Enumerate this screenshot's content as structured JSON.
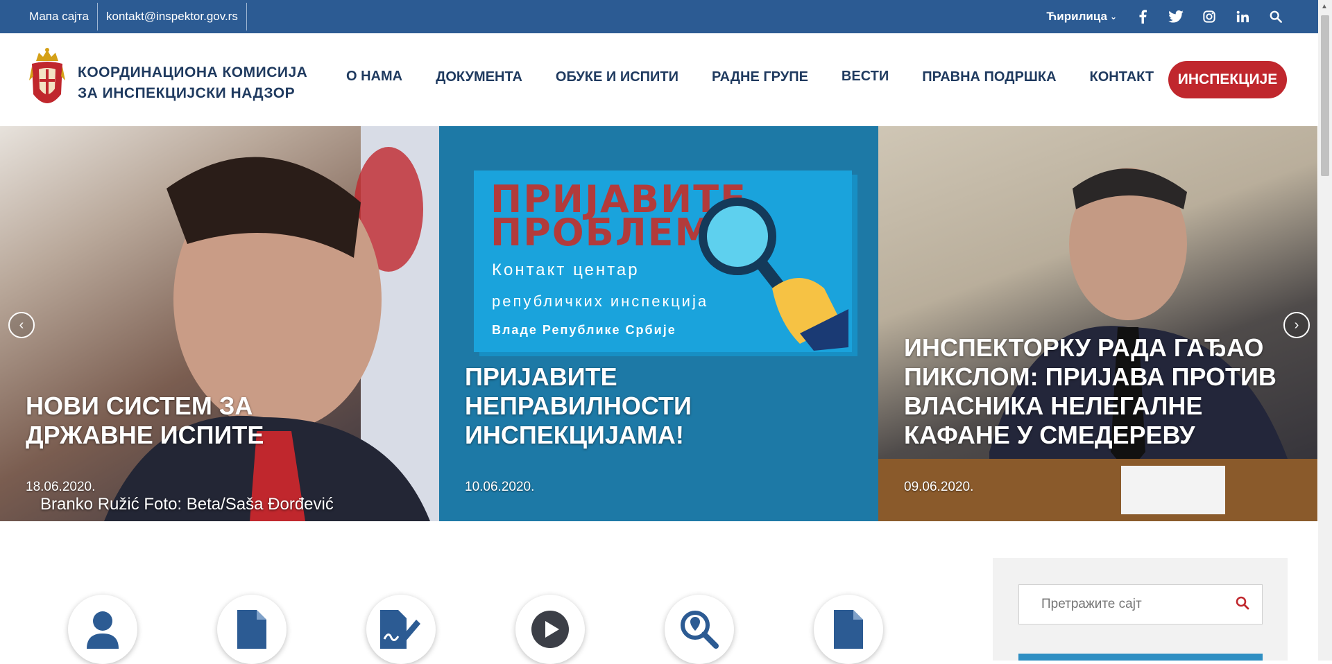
{
  "topbar": {
    "sitemap": "Мапа сајта",
    "email": "kontakt@inspektor.gov.rs",
    "language": "Ћирилица",
    "social": [
      "facebook-icon",
      "twitter-icon",
      "instagram-icon",
      "linkedin-icon",
      "search-icon"
    ]
  },
  "header": {
    "brand_line1": "КООРДИНАЦИОНА КОМИСИЈА",
    "brand_line2": "ЗА ИНСПЕКЦИЈСКИ НАДЗОР",
    "nav": [
      "О НАМА",
      "ДОКУМЕНТА",
      "ОБУКЕ И ИСПИТИ",
      "РАДНЕ ГРУПЕ",
      "ВЕСТИ",
      "ПРАВНА ПОДРШКА",
      "КОНТАКТ"
    ],
    "cta": "ИНСПЕКЦИЈЕ"
  },
  "slides": [
    {
      "title": "НОВИ СИСТЕМ ЗА ДРЖАВНЕ ИСПИТЕ",
      "date": "18.06.2020.",
      "caption": "Branko Ružić Foto: Beta/Saša Đorđević"
    },
    {
      "title": "ПРИЈАВИТЕ НЕПРАВИЛНОСТИ ИНСПЕКЦИЈАМА!",
      "date": "10.06.2020.",
      "poster": {
        "line1": "ПРИЈАВИТЕ",
        "line2": "ПРОБЛЕМ!",
        "line3": "Контакт центар",
        "line4": "републичких инспекција",
        "line5": "Владе Републике Србије"
      }
    },
    {
      "title": "ИНСПЕКТОРКУ РАДА ГАЂАО ПИКСЛОМ: ПРИЈАВА ПРОТИВ ВЛАСНИКА НЕЛЕГАЛНЕ КАФАНЕ У СМЕДЕРЕВУ",
      "date": "09.06.2020."
    }
  ],
  "quick_icons": [
    "user-icon",
    "document-icon",
    "signature-icon",
    "play-icon",
    "search-location-icon",
    "file-icon"
  ],
  "sidebar": {
    "search_placeholder": "Претражите сајт"
  },
  "colors": {
    "topbar": "#2c5b93",
    "brand": "#1f3a5f",
    "cta": "#c0272d",
    "slide2": "#1d79a6"
  }
}
